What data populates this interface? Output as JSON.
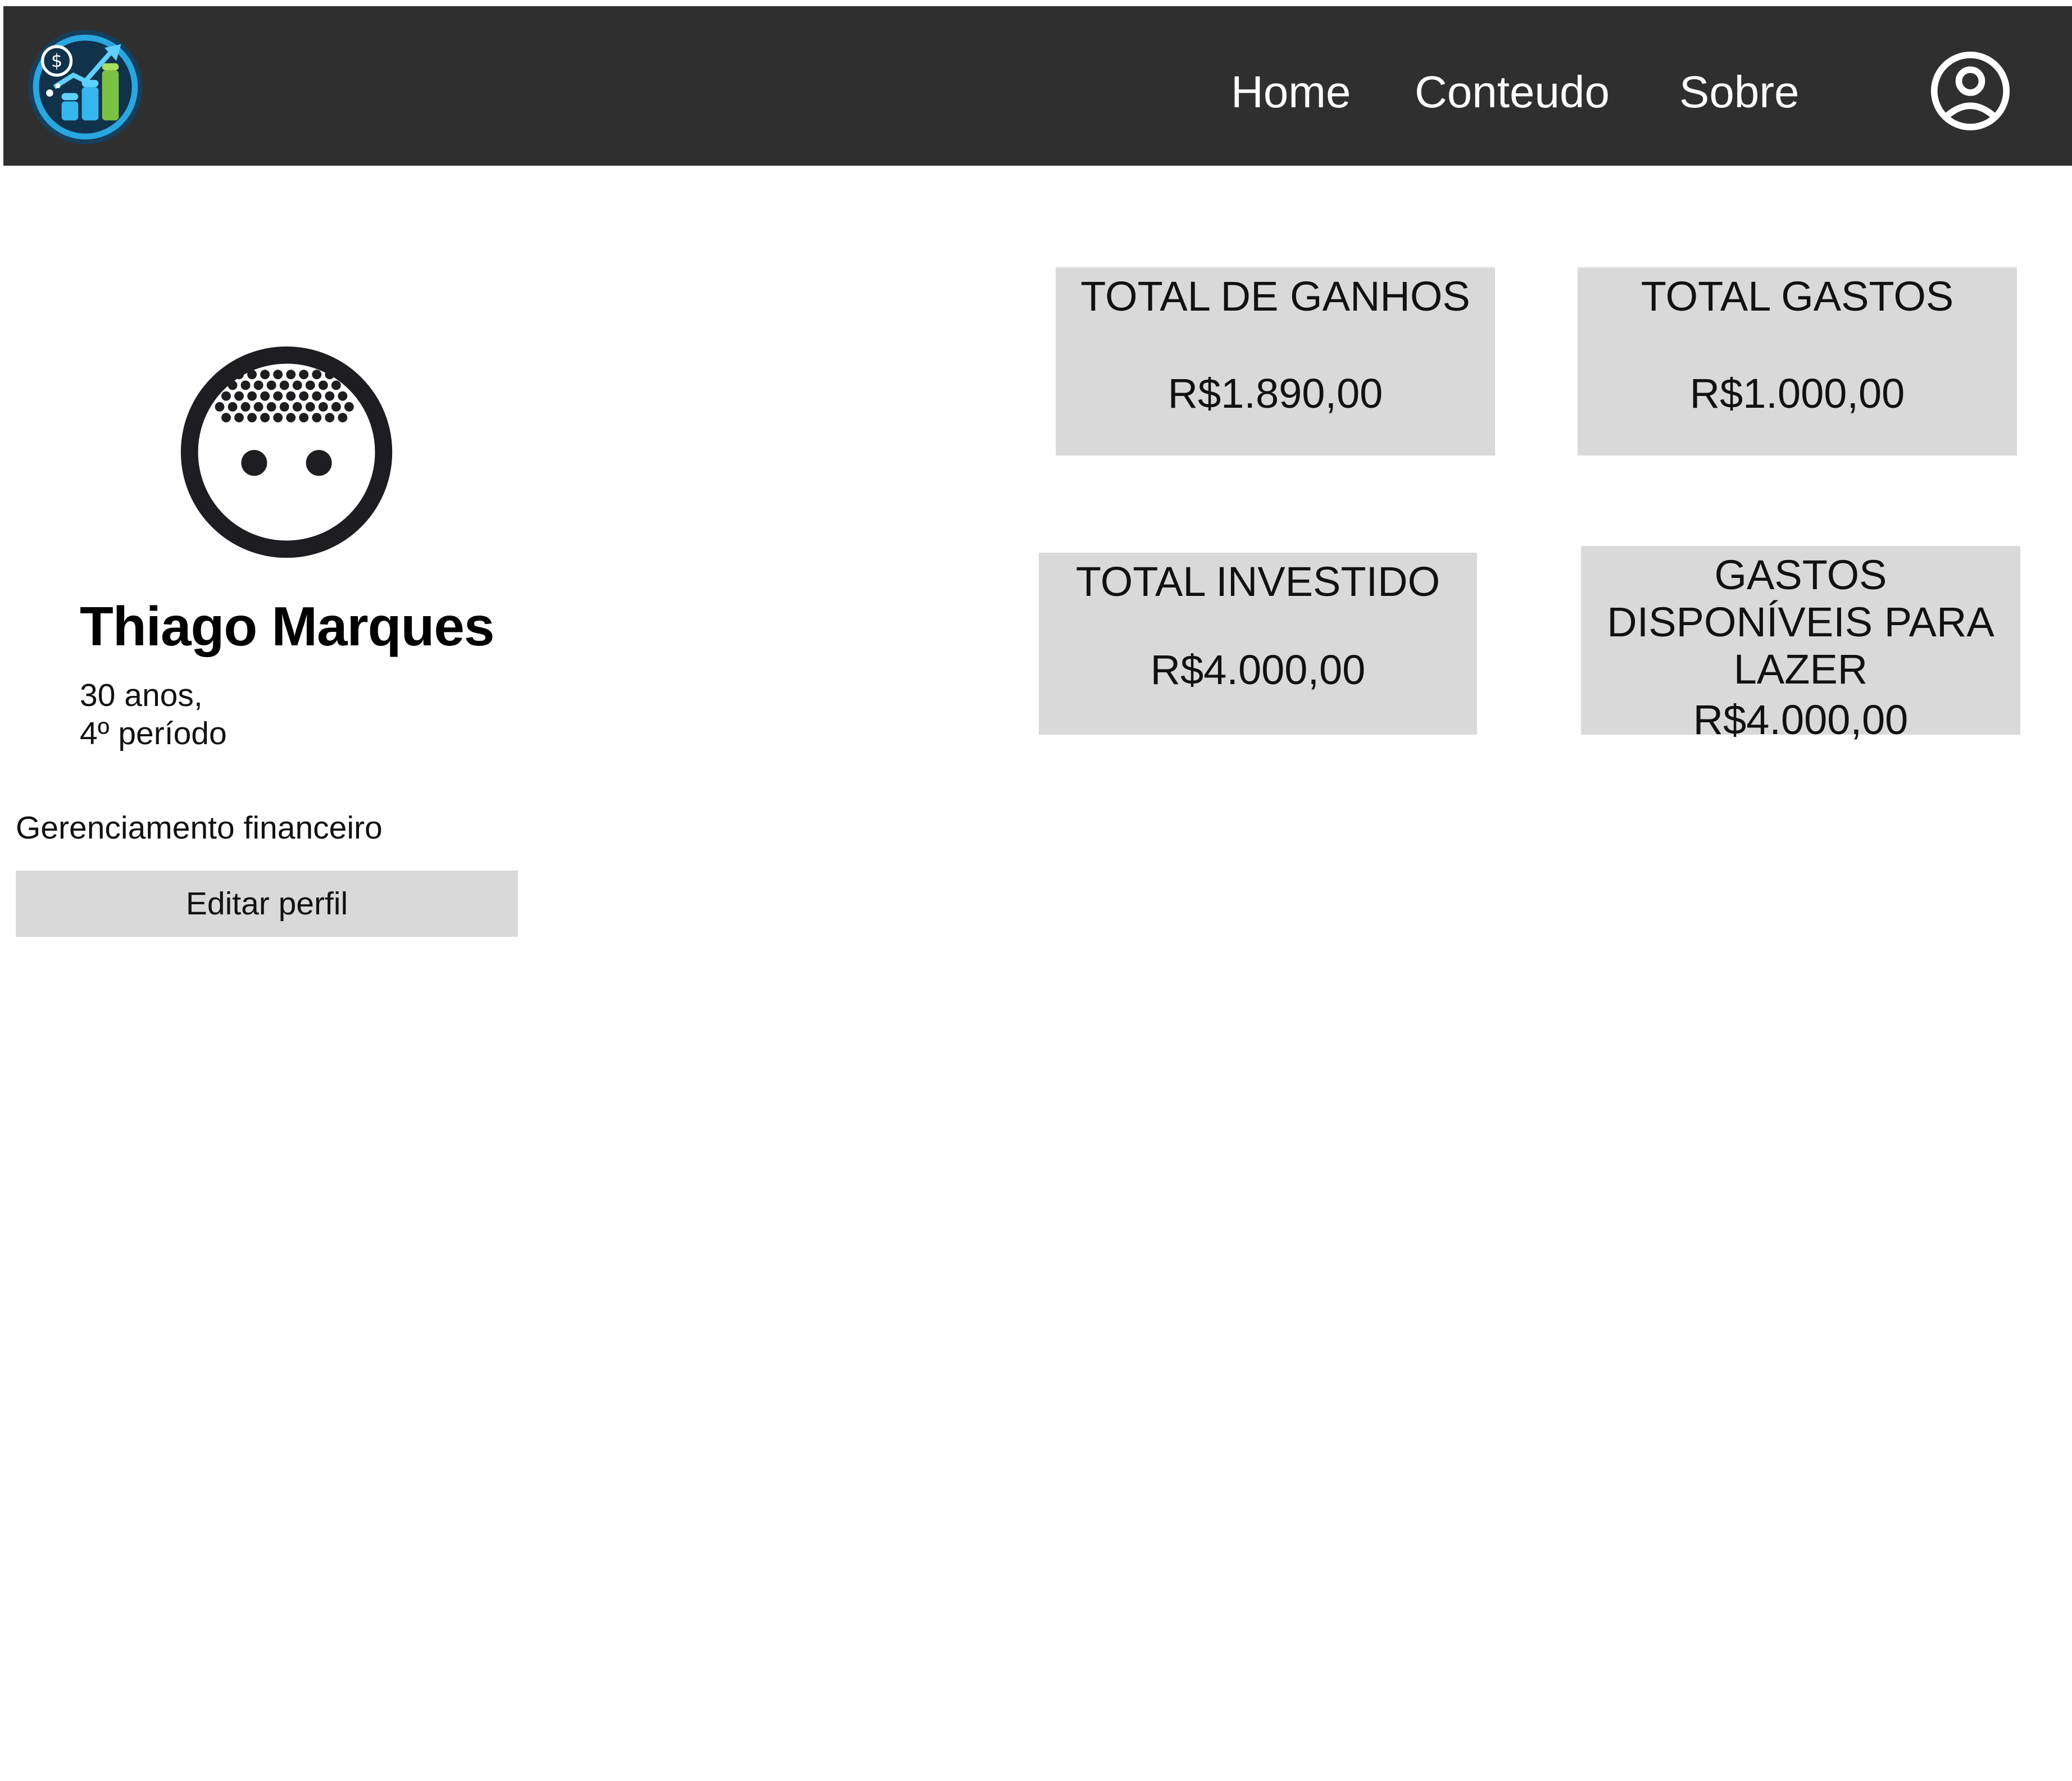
{
  "navbar": {
    "logo_icon": "finance-growth-logo-icon",
    "links": [
      {
        "label": "Home"
      },
      {
        "label": "Conteudo"
      },
      {
        "label": "Sobre"
      }
    ],
    "user_icon": "user-circle-icon",
    "background": "#2f2f2f"
  },
  "profile": {
    "avatar_icon": "avatar-face-icon",
    "name": "Thiago Marques",
    "age": "30 anos,",
    "period": "4º período",
    "description": "Gerenciamento financeiro",
    "edit_label": "Editar perfil"
  },
  "stats": {
    "ganhos": {
      "label": "TOTAL DE GANHOS",
      "value": "R$1.890,00"
    },
    "gastos": {
      "label": "TOTAL GASTOS",
      "value": "R$1.000,00"
    },
    "investido": {
      "label": "TOTAL INVESTIDO",
      "value": "R$4.000,00"
    },
    "lazer": {
      "label": "GASTOS DISPONÍVEIS PARA LAZER",
      "value": "R$4.000,00"
    }
  },
  "colors": {
    "card_background": "#d9d9d9",
    "nav_text": "#ffffff"
  }
}
